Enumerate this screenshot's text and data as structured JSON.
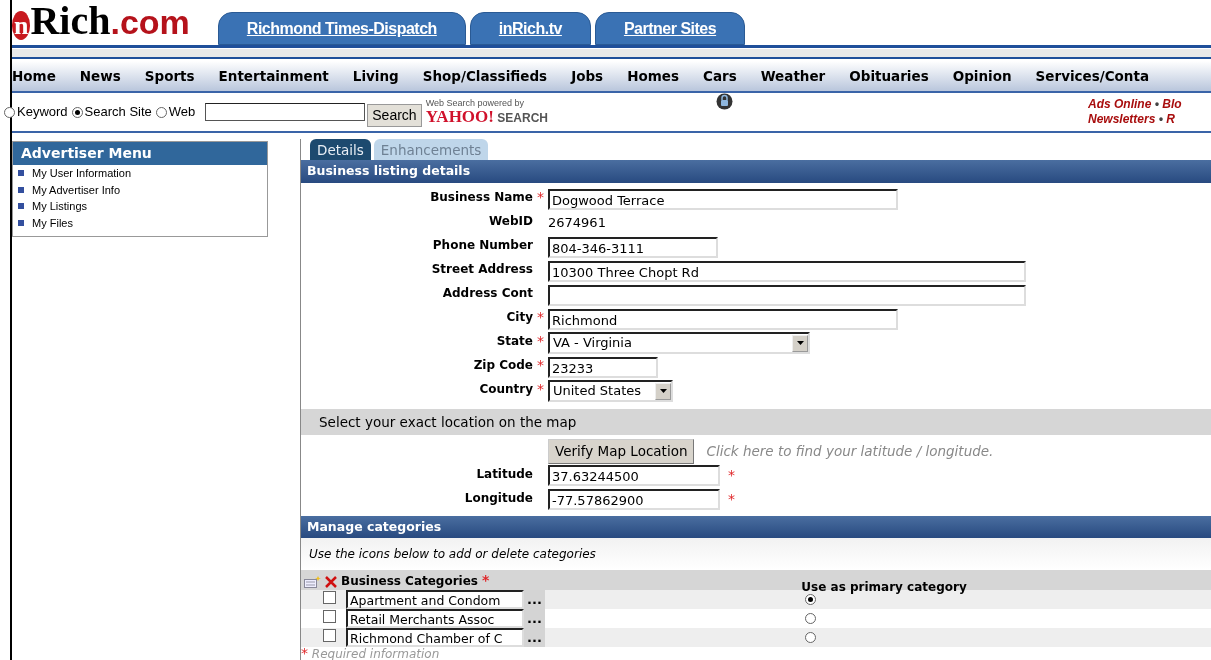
{
  "header": {
    "logo": {
      "prefix": "n",
      "name": "Rich",
      "suffix": ".com"
    },
    "site_tabs": [
      "Richmond Times-Dispatch",
      "inRich.tv",
      "Partner Sites"
    ]
  },
  "nav": [
    "Home",
    "News",
    "Sports",
    "Entertainment",
    "Living",
    "Shop/Classifieds",
    "Jobs",
    "Homes",
    "Cars",
    "Weather",
    "Obituaries",
    "Opinion",
    "Services/Conta"
  ],
  "search": {
    "options": [
      {
        "label": "Keyword",
        "selected": false
      },
      {
        "label": "Search Site",
        "selected": true
      },
      {
        "label": "Web",
        "selected": false
      }
    ],
    "button": "Search",
    "powered_by": "Web Search powered by",
    "provider": "YAHOO!",
    "provider_suffix": "SEARCH"
  },
  "quick_links": [
    {
      "links": [
        "Ads Online",
        "Blo"
      ],
      "separator": "•"
    },
    {
      "links": [
        "Newsletters",
        "R"
      ],
      "separator": "•"
    }
  ],
  "sidebar": {
    "title": "Advertiser Menu",
    "items": [
      "My User Information",
      "My Advertiser Info",
      "My Listings",
      "My Files"
    ]
  },
  "tabs": [
    {
      "label": "Details",
      "selected": true
    },
    {
      "label": "Enhancements",
      "selected": false
    }
  ],
  "listing": {
    "title": "Business listing details",
    "fields": [
      {
        "label": "Business Name",
        "required": true,
        "kind": "text",
        "value": "Dogwood Terrace"
      },
      {
        "label": "WebID",
        "required": false,
        "kind": "static",
        "value": "2674961"
      },
      {
        "label": "Phone Number",
        "required": false,
        "kind": "text",
        "value": "804-346-3111"
      },
      {
        "label": "Street Address",
        "required": false,
        "kind": "text",
        "value": "10300 Three Chopt Rd"
      },
      {
        "label": "Address Cont",
        "required": false,
        "kind": "text"
      },
      {
        "label": "City",
        "required": true,
        "kind": "text",
        "value": "Richmond"
      },
      {
        "label": "State",
        "required": true,
        "kind": "select",
        "value": "VA - Virginia"
      },
      {
        "label": "Zip Code",
        "required": true,
        "kind": "text",
        "value": "23233"
      },
      {
        "label": "Country",
        "required": true,
        "kind": "select",
        "value": "United States"
      }
    ]
  },
  "map": {
    "title": "Select your exact location on the map",
    "button": "Verify Map Location",
    "hint": "Click here to find your latitude / longitude.",
    "coordinates": [
      {
        "label": "Latitude",
        "required": true,
        "value": "37.63244500"
      },
      {
        "label": "Longitude",
        "required": true,
        "value": "-77.57862900"
      }
    ]
  },
  "categories": {
    "title": "Manage categories",
    "hint": "Use the icons below to add or delete categories",
    "column": "Business Categories",
    "column_required": true,
    "primary_column": "Use as primary category",
    "rows": [
      {
        "checked": false,
        "value": "Apartment and Condom",
        "browse": "...",
        "selected": true
      },
      {
        "checked": false,
        "value": "Retail Merchants Assoc",
        "browse": "...",
        "selected": false
      },
      {
        "checked": false,
        "value": "Richmond Chamber of C",
        "browse": "...",
        "selected": false
      }
    ]
  },
  "footnote": {
    "mark": "*",
    "text": "Required information"
  }
}
